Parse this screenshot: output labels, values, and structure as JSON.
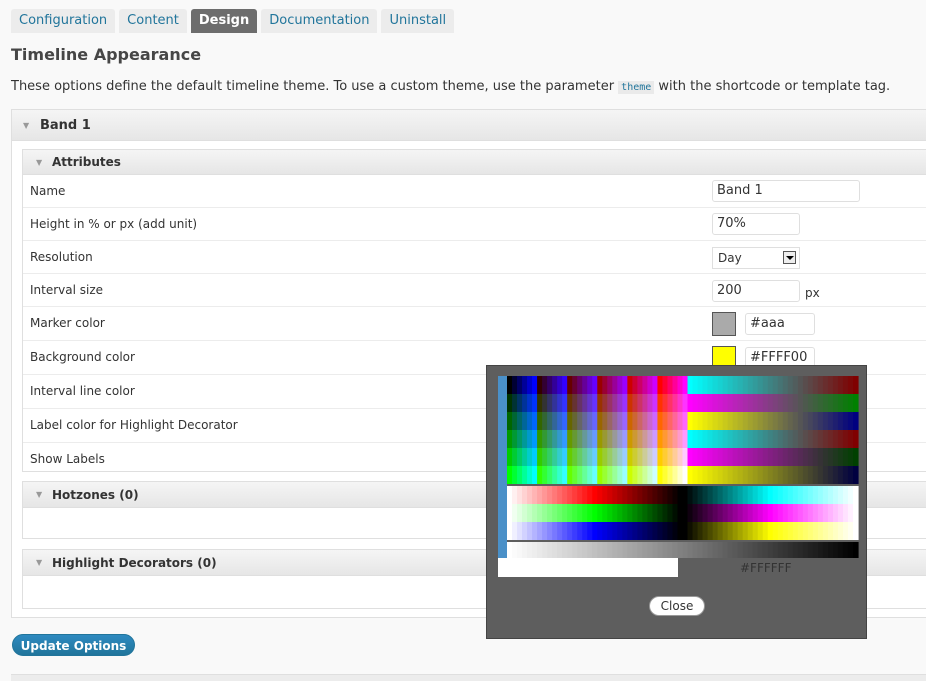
{
  "tabs": [
    {
      "label": "Configuration"
    },
    {
      "label": "Content"
    },
    {
      "label": "Design"
    },
    {
      "label": "Documentation"
    },
    {
      "label": "Uninstall"
    }
  ],
  "page": {
    "title": "Timeline Appearance",
    "intro_before": "These options define the default timeline theme. To use a custom theme, use the parameter ",
    "intro_code": "theme",
    "intro_after": " with the shortcode or template tag."
  },
  "band": {
    "title": "Band 1",
    "attributes_title": "Attributes",
    "rows": [
      {
        "label": "Name",
        "value": "Band 1"
      },
      {
        "label": "Height in % or px (add unit)",
        "value": "70%"
      },
      {
        "label": "Resolution",
        "value": "Day"
      },
      {
        "label": "Interval size",
        "value": "200",
        "unit": "px"
      },
      {
        "label": "Marker color",
        "value": "#aaa",
        "color": "#aaaaaa"
      },
      {
        "label": "Background color",
        "value": "#FFFF00",
        "color": "#FFFF00"
      },
      {
        "label": "Interval line color"
      },
      {
        "label": "Label color for Highlight Decorator"
      },
      {
        "label": "Show Labels"
      }
    ],
    "hotzones_title": "Hotzones (0)",
    "decorators_title": "Highlight Decorators (0)"
  },
  "update_button": "Update Options",
  "color_picker": {
    "hex": "#FFFFFF",
    "close_label": "Close",
    "accent": "#4a90c8"
  }
}
